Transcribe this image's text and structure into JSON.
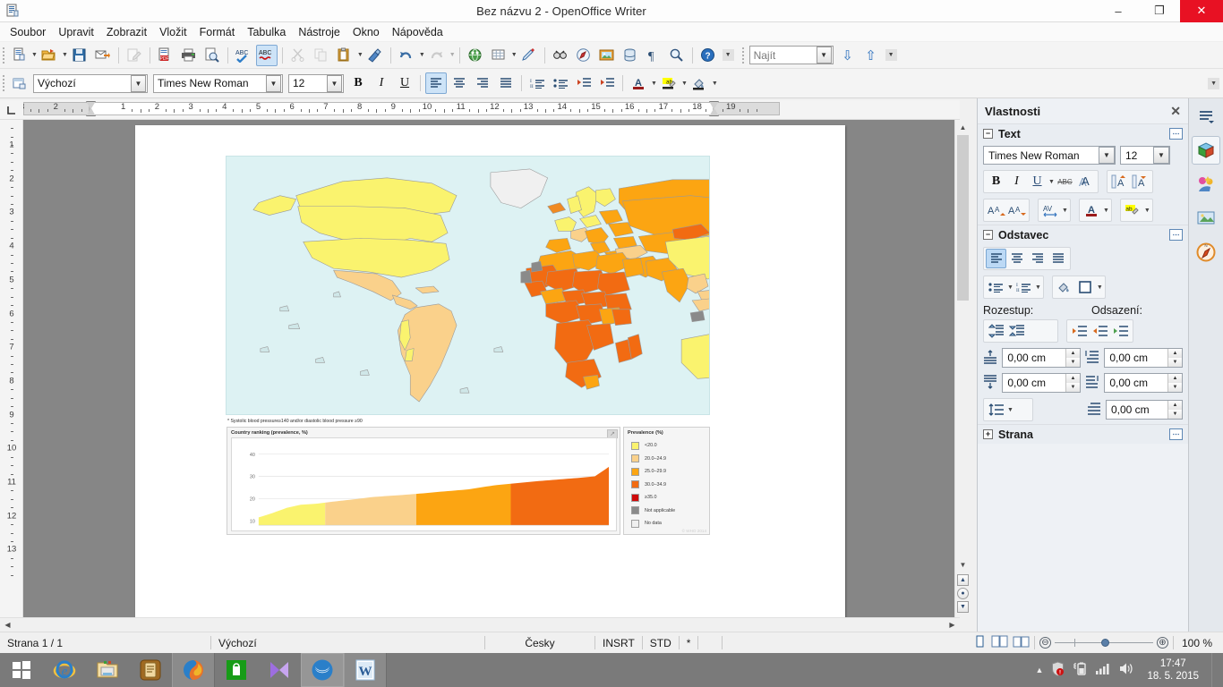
{
  "window": {
    "title": "Bez názvu 2 - OpenOffice Writer",
    "app_icon": "document-icon",
    "minimize": "–",
    "maximize": "❐",
    "close": "✕"
  },
  "menubar": {
    "items": [
      {
        "label": "Soubor",
        "accel": "S"
      },
      {
        "label": "Upravit",
        "accel": "U"
      },
      {
        "label": "Zobrazit",
        "accel": "Z"
      },
      {
        "label": "Vložit",
        "accel": "ž"
      },
      {
        "label": "Formát",
        "accel": "o"
      },
      {
        "label": "Tabulka",
        "accel": "a"
      },
      {
        "label": "Nástroje",
        "accel": "t"
      },
      {
        "label": "Okno",
        "accel": "k"
      },
      {
        "label": "Nápověda",
        "accel": "N"
      }
    ]
  },
  "toolbar_standard": {
    "buttons": [
      {
        "name": "new-document",
        "glyph": "🗋"
      },
      {
        "name": "new-dropdown",
        "glyph": "▾"
      },
      {
        "name": "open-document",
        "glyph": "📂"
      },
      {
        "name": "open-dropdown",
        "glyph": "▾"
      },
      {
        "name": "save-document",
        "glyph": "💾"
      },
      {
        "name": "send-email",
        "glyph": "✉"
      },
      {
        "name": "edit-file",
        "glyph": "📝",
        "disabled": true
      },
      {
        "name": "export-pdf",
        "glyph": "📄"
      },
      {
        "name": "print-file",
        "glyph": "🖨"
      },
      {
        "name": "print-preview",
        "glyph": "🔍"
      },
      {
        "name": "spelling-check",
        "glyph": "ABC"
      },
      {
        "name": "autospellcheck",
        "glyph": "ABC",
        "active": true
      },
      {
        "name": "cut",
        "glyph": "✂",
        "disabled": true
      },
      {
        "name": "copy",
        "glyph": "⧉",
        "disabled": true
      },
      {
        "name": "paste",
        "glyph": "📋"
      },
      {
        "name": "paste-dropdown",
        "glyph": "▾"
      },
      {
        "name": "clone-formatting",
        "glyph": "🖌"
      },
      {
        "name": "undo",
        "glyph": "↺"
      },
      {
        "name": "undo-dropdown",
        "glyph": "▾"
      },
      {
        "name": "redo",
        "glyph": "↻",
        "disabled": true
      },
      {
        "name": "redo-dropdown",
        "glyph": "▾",
        "disabled": true
      },
      {
        "name": "hyperlink",
        "glyph": "🌍"
      },
      {
        "name": "insert-table",
        "glyph": "▦"
      },
      {
        "name": "table-dropdown",
        "glyph": "▾"
      },
      {
        "name": "show-draw-functions",
        "glyph": "✏"
      },
      {
        "name": "find-replace",
        "glyph": "🔭"
      },
      {
        "name": "navigator",
        "glyph": "🧭"
      },
      {
        "name": "insert-image",
        "glyph": "🖼"
      },
      {
        "name": "data-sources",
        "glyph": "🗄"
      },
      {
        "name": "formatting-marks",
        "glyph": "¶"
      },
      {
        "name": "zoom",
        "glyph": "🔍"
      },
      {
        "name": "help",
        "glyph": "?"
      },
      {
        "name": "toolbar-overflow",
        "glyph": "▾"
      }
    ],
    "find_placeholder": "Najít",
    "find_value": "",
    "find_next": "⇩",
    "find_prev": "⇧",
    "find_overflow": "▾"
  },
  "toolbar_formatting": {
    "paragraph_style_icon": "apply-style-icon",
    "paragraph_style": "Výchozí",
    "font_name": "Times New Roman",
    "font_size": "12",
    "bold": "B",
    "italic": "I",
    "underline": "U",
    "align_left": "≡",
    "align_center": "≡",
    "align_right": "≡",
    "align_justified": "≡",
    "ordered_list": "⅒",
    "unordered_list": "•≡",
    "decrease_indent": "⇤",
    "increase_indent": "⇥",
    "font_color": "A",
    "highlight_color": "ab",
    "background_color": "🪣",
    "overflow": "▾"
  },
  "ruler": {
    "unit": "cm",
    "horizontal_numbers": [
      "1",
      "1",
      "2",
      "3",
      "4",
      "5",
      "6",
      "7",
      "8",
      "9",
      "10",
      "11",
      "12",
      "13",
      "14",
      "15",
      "16",
      "17",
      "18"
    ],
    "vertical_numbers": [
      "1",
      "2",
      "3",
      "4",
      "5",
      "6",
      "7",
      "8",
      "9",
      "10",
      "11",
      "12",
      "13"
    ],
    "corner_icon": "tab-stop-icon"
  },
  "document": {
    "figure": {
      "footnote": "* Systolic blood pressure≥140 and/or diastolic blood pressure ≥90",
      "ranking_panel_title": "Country ranking (prevalence, %)",
      "legend_panel_title": "Prevalence (%)",
      "credit": "© WHO 2014",
      "expand_icon": "expand-icon"
    }
  },
  "chart_data": [
    {
      "type": "area",
      "title": "Country ranking (prevalence, %)",
      "xlabel": "",
      "ylabel": "",
      "ylim": [
        8,
        44
      ],
      "yticks": [
        10,
        20,
        30,
        40
      ],
      "grid": true,
      "legend_position": "right",
      "x": [
        0,
        4,
        8,
        12,
        16,
        20,
        24,
        28,
        32,
        36,
        40,
        44,
        48,
        52,
        56,
        60,
        64,
        68,
        72,
        76,
        80,
        84,
        88,
        92,
        96,
        100
      ],
      "values": [
        11.5,
        13.5,
        15.8,
        17.2,
        17.6,
        18.4,
        19.1,
        19.8,
        20.6,
        21.1,
        21.5,
        22.0,
        22.5,
        23.1,
        23.6,
        24.2,
        25.2,
        26.1,
        26.7,
        27.3,
        27.9,
        28.4,
        28.9,
        29.4,
        30.0,
        34.3
      ],
      "band_breaks": [
        0,
        19,
        45,
        72,
        100
      ],
      "band_colors": [
        "#FAF36E",
        "#FAD18B",
        "#FCA512",
        "#F26B12"
      ]
    },
    {
      "type": "heatmap",
      "title": "Prevalence (%)",
      "legend_entries": [
        {
          "label": "<20.0",
          "color": "#FAF36E"
        },
        {
          "label": "20.0–24.9",
          "color": "#FAD18B"
        },
        {
          "label": "25.0–29.9",
          "color": "#FCA512"
        },
        {
          "label": "30.0–34.9",
          "color": "#F26B12"
        },
        {
          "label": "≥35.0",
          "color": "#CE0A0A"
        },
        {
          "label": "Not applicable",
          "color": "#8A8A8A"
        },
        {
          "label": "No data",
          "color": "#F0F0F0"
        }
      ]
    }
  ],
  "sidebar": {
    "title": "Vlastnosti",
    "close_icon": "✕",
    "panels": {
      "text": {
        "title": "Text",
        "collapse_icon": "⊟",
        "more_icon": "⋯",
        "font_name": "Times New Roman",
        "font_size": "12",
        "bold": "B",
        "italic": "I",
        "underline": "U",
        "underline_dropdown": "▾",
        "strikethrough": "ABC",
        "shadow": "A",
        "superscript": "A↑",
        "subscript": "A↓",
        "grow_font": "A",
        "shrink_font": "A",
        "spacing": "AV",
        "spacing_dropdown": "▾",
        "font_color": "A",
        "font_color_dropdown": "▾",
        "highlight": "ab",
        "highlight_dropdown": "▾"
      },
      "paragraph": {
        "title": "Odstavec",
        "collapse_icon": "⊟",
        "more_icon": "⋯",
        "align_left": "≡",
        "align_center": "≡",
        "align_right": "≡",
        "align_justify": "≡",
        "bullet_list": "•≡",
        "bullet_dropdown": "▾",
        "number_list": "⅒",
        "number_dropdown": "▾",
        "background_color": "🪣",
        "border": "▢",
        "border_dropdown": "▾",
        "spacing_label": "Rozestup:",
        "indent_label": "Odsazení:",
        "increase_spacing": "⇕",
        "decrease_spacing": "⇕",
        "increase_indent": "⇥",
        "decrease_indent": "⇤",
        "hanging_indent": "⇥",
        "spacing_above": "0,00 cm",
        "spacing_below": "0,00 cm",
        "indent_before": "0,00 cm",
        "indent_after": "0,00 cm",
        "indent_first_line": "0,00 cm",
        "line_spacing": "⇕",
        "line_spacing_dropdown": "▾"
      },
      "page": {
        "title": "Strana",
        "expand_icon": "⊞",
        "more_icon": "⋯"
      }
    },
    "rail": [
      {
        "name": "sidebar-settings",
        "glyph": "≡"
      },
      {
        "name": "properties-deck",
        "glyph": "🧊",
        "selected": true
      },
      {
        "name": "gallery-deck",
        "glyph": "🎨"
      },
      {
        "name": "styles-deck",
        "glyph": "🖼"
      },
      {
        "name": "navigator-deck",
        "glyph": "🧭"
      }
    ]
  },
  "statusbar": {
    "page": "Strana 1 / 1",
    "page_style": "Výchozí",
    "language": "Česky",
    "insert_mode": "INSRT",
    "selection_mode": "STD",
    "modified": "*",
    "view_single": "🗋",
    "view_multi": "🗐",
    "view_book": "📖",
    "zoom_out": "⊖",
    "zoom_in": "⊕",
    "zoom_value": "100 %"
  },
  "taskbar": {
    "start": "start-button",
    "items": [
      {
        "name": "internet-explorer",
        "glyph": "e"
      },
      {
        "name": "file-explorer",
        "glyph": "🗂"
      },
      {
        "name": "notes-app",
        "glyph": "🗒"
      },
      {
        "name": "firefox",
        "glyph": "🦊",
        "running": true
      },
      {
        "name": "windows-store",
        "glyph": "🛍"
      },
      {
        "name": "media-player",
        "glyph": "▶"
      },
      {
        "name": "openoffice-writer",
        "glyph": "◉",
        "active": true
      },
      {
        "name": "word-viewer",
        "glyph": "W",
        "running": true
      }
    ],
    "tray": {
      "expand": "▲",
      "security": "🛡",
      "battery": "🔋",
      "network": "📶",
      "volume": "🔊",
      "time": "17:47",
      "date": "18. 5. 2015"
    }
  }
}
